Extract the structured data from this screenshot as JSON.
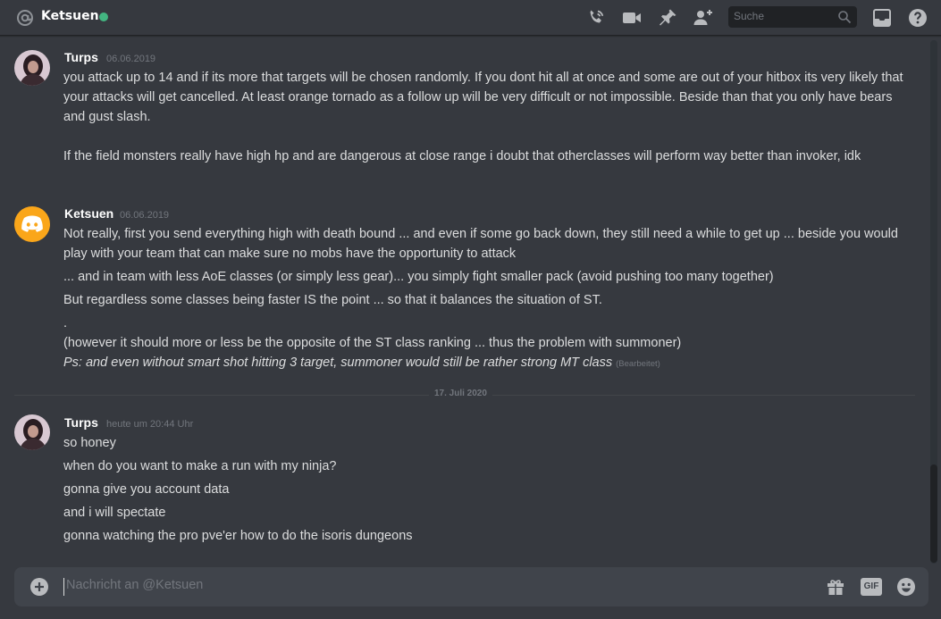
{
  "header": {
    "channel_name": "Ketsuen",
    "status_color": "#43b581",
    "search_placeholder": "Suche",
    "icons": [
      "at-icon",
      "voice-call-icon",
      "video-call-icon",
      "pin-icon",
      "add-friend-icon",
      "search-icon",
      "inbox-icon",
      "help-icon"
    ]
  },
  "messages": [
    {
      "author": "Turps",
      "timestamp": "06.06.2019",
      "lines": [
        "you attack up to 14 and if its more that targets will be chosen randomly. If you dont hit all at once and some are out of your hitbox its very likely that your attacks will get cancelled. At least orange tornado as a follow up will be very difficult or not impossible. Beside than that you only have bears and gust slash.",
        "If the field monsters really have high hp and are dangerous at close range i doubt that otherclasses will perform way better than invoker, idk"
      ]
    },
    {
      "author": "Ketsuen",
      "timestamp": "06.06.2019",
      "lines": [
        "Not really, first you send everything high with death bound ... and even if some go back down, they still need a while to get up ... beside you would play with your team that can make sure no mobs have the opportunity to attack",
        "... and in team with less AoE classes (or simply less gear)... you simply fight smaller pack (avoid pushing too many together)",
        "But regardless some classes being faster IS the point ... so that it balances the situation of ST.",
        ".",
        "(however it should more or less be the opposite of the ST class ranking ... thus the problem with summoner)",
        "Ps: and even without smart shot hitting 3 target, summoner would still be rather strong MT class"
      ],
      "edited_label": "(Bearbeitet)"
    },
    {
      "author": "Turps",
      "timestamp": "heute um 20:44 Uhr",
      "lines": [
        "so honey",
        "when do you want to make a run with my ninja?",
        "gonna give you account data",
        "and i will spectate",
        "gonna watching the pro pve'er how to do the isoris dungeons"
      ]
    }
  ],
  "date_divider": "17. Juli 2020",
  "composer": {
    "placeholder": "Nachricht an @Ketsuen",
    "gif_label": "GIF",
    "icons": [
      "plus-icon",
      "gift-icon",
      "gif-icon",
      "emoji-icon"
    ]
  },
  "colors": {
    "background": "#36393f",
    "composer_bg": "#40444b",
    "discord_avatar": "#faa61a",
    "online": "#43b581"
  }
}
